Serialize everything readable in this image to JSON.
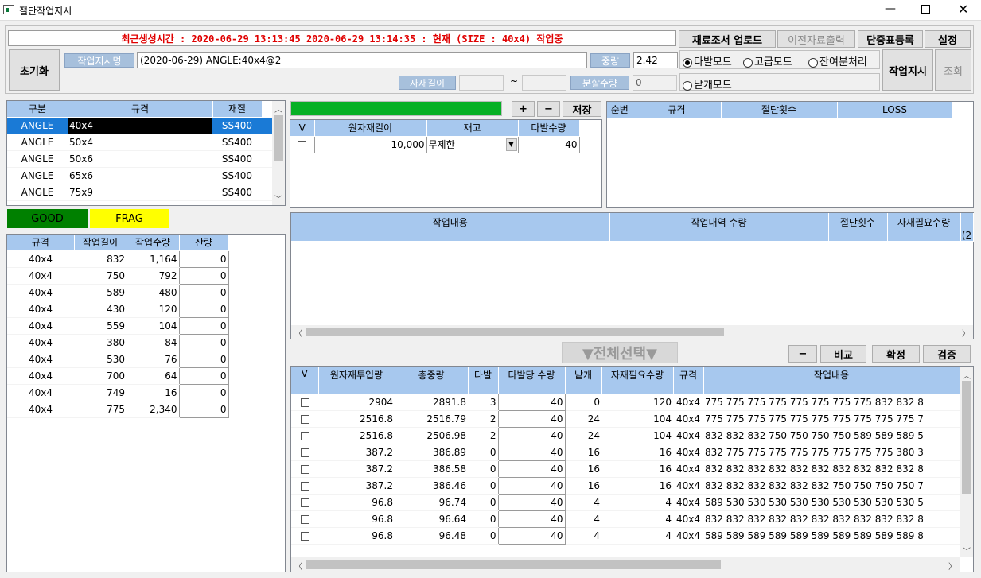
{
  "window": {
    "title": "절단작업지시"
  },
  "header": {
    "status_text": "최근생성시간 : 2020-06-29 13:13:45  2020-06-29 13:14:35 : 현재 (SIZE : 40x4) 작업중",
    "buttons": {
      "upload": "재료조서 업로드",
      "prev_output": "이전자료출력",
      "unit_weight": "단중표등록",
      "settings": "설정",
      "reset": "초기화",
      "instruct": "작업지시",
      "query": "조회"
    },
    "job_name_label": "작업지시명",
    "job_name_value": "(2020-06-29) ANGLE:40x4@2",
    "weight_label": "중량",
    "weight_value": "2.42",
    "material_len_label": "자재길이",
    "tilde": "~",
    "split_qty_label": "분할수량",
    "split_qty_value": "0",
    "modes": {
      "multi": "다발모드",
      "advanced": "고급모드",
      "remain": "잔여분처리",
      "single": "낱개모드"
    }
  },
  "spec_table": {
    "headers": [
      "구분",
      "규격",
      "재질"
    ],
    "rows": [
      [
        "ANGLE",
        "40x4",
        "SS400"
      ],
      [
        "ANGLE",
        "50x4",
        "SS400"
      ],
      [
        "ANGLE",
        "50x6",
        "SS400"
      ],
      [
        "ANGLE",
        "65x6",
        "SS400"
      ],
      [
        "ANGLE",
        "75x9",
        "SS400"
      ]
    ]
  },
  "legend": {
    "good": "GOOD",
    "frag": "FRAG",
    "good_color": "#008000",
    "frag_color": "#ffff00"
  },
  "work_table": {
    "headers": [
      "규격",
      "작업길이",
      "작업수량",
      "잔량"
    ],
    "rows": [
      [
        "40x4",
        "832",
        "1,164",
        "0"
      ],
      [
        "40x4",
        "750",
        "792",
        "0"
      ],
      [
        "40x4",
        "589",
        "480",
        "0"
      ],
      [
        "40x4",
        "430",
        "120",
        "0"
      ],
      [
        "40x4",
        "559",
        "104",
        "0"
      ],
      [
        "40x4",
        "380",
        "84",
        "0"
      ],
      [
        "40x4",
        "530",
        "76",
        "0"
      ],
      [
        "40x4",
        "700",
        "64",
        "0"
      ],
      [
        "40x4",
        "749",
        "16",
        "0"
      ],
      [
        "40x4",
        "775",
        "2,340",
        "0"
      ]
    ]
  },
  "raw_panel": {
    "progress": 1.0,
    "plus": "+",
    "minus": "−",
    "save": "저장",
    "headers": [
      "V",
      "원자재길이",
      "재고",
      "다발수량"
    ],
    "row": {
      "length": "10,000",
      "stock": "무제한",
      "bundle": "40"
    }
  },
  "seq_table": {
    "headers": [
      "순번",
      "규격",
      "절단횟수",
      "LOSS"
    ]
  },
  "content_table": {
    "headers": [
      "작업내용",
      "작업내역 수량",
      "절단횟수",
      "자재필요수량",
      "(2"
    ]
  },
  "select_all": "▼전체선택▼",
  "bottom_buttons": {
    "minus": "−",
    "compare": "비교",
    "confirm": "확정",
    "verify": "검증"
  },
  "result_table": {
    "headers": [
      "V",
      "원자재투입량",
      "총중량",
      "다발",
      "다발당 수량",
      "낱개",
      "자재필요수량",
      "규격",
      "작업내용"
    ],
    "rows": [
      [
        "2904",
        "2891.8",
        "3",
        "40",
        "0",
        "120",
        "40x4",
        "775 775 775 775 775 775 775 775 832 832 8"
      ],
      [
        "2516.8",
        "2516.79",
        "2",
        "40",
        "24",
        "104",
        "40x4",
        "775 775 775 775 775 775 775 775 775 775 7"
      ],
      [
        "2516.8",
        "2506.98",
        "2",
        "40",
        "24",
        "104",
        "40x4",
        "832 832 832 750 750 750 750 589 589 589 5"
      ],
      [
        "387.2",
        "386.89",
        "0",
        "40",
        "16",
        "16",
        "40x4",
        "832 775 775 775 775 775 775 775 775 380 3"
      ],
      [
        "387.2",
        "386.58",
        "0",
        "40",
        "16",
        "16",
        "40x4",
        "832 832 832 832 832 832 832 832 832 832 8"
      ],
      [
        "387.2",
        "386.46",
        "0",
        "40",
        "16",
        "16",
        "40x4",
        "832 832 832 832 832 832 750 750 750 750 7"
      ],
      [
        "96.8",
        "96.74",
        "0",
        "40",
        "4",
        "4",
        "40x4",
        "589 530 530 530 530 530 530 530 530 530 5"
      ],
      [
        "96.8",
        "96.64",
        "0",
        "40",
        "4",
        "4",
        "40x4",
        "832 832 832 832 832 832 832 832 832 832 8"
      ],
      [
        "96.8",
        "96.48",
        "0",
        "40",
        "4",
        "4",
        "40x4",
        "589 589 589 589 589 589 589 589 589 589 8"
      ]
    ]
  }
}
